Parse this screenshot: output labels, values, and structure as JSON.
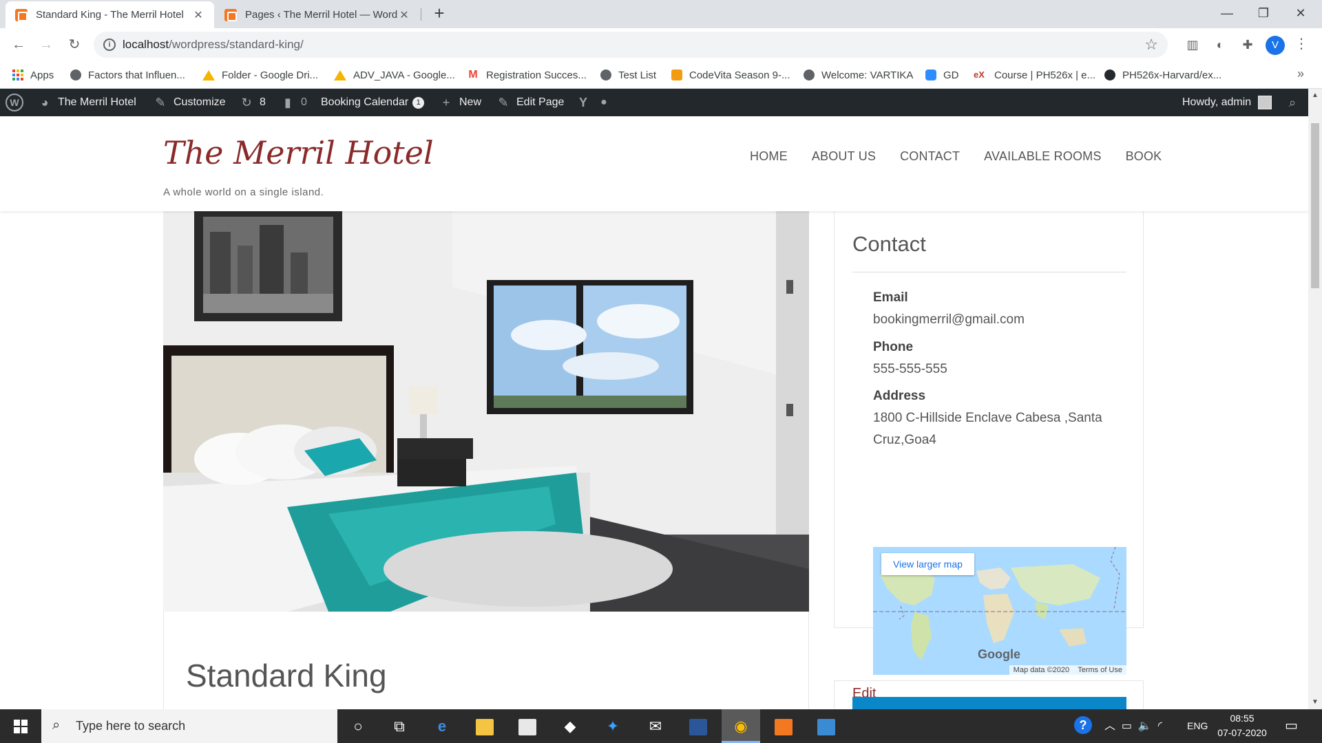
{
  "browser": {
    "tabs": [
      {
        "title": "Standard King - The Merril Hotel",
        "active": true
      },
      {
        "title": "Pages ‹ The Merril Hotel — Word",
        "active": false
      }
    ],
    "url_host": "localhost",
    "url_path": "/wordpress/standard-king/",
    "profile_initial": "V",
    "bookmarks": [
      {
        "label": "Apps",
        "icon": "apps-grid-icon"
      },
      {
        "label": "Factors that Influen...",
        "icon": "globe-icon"
      },
      {
        "label": "Folder - Google Dri...",
        "icon": "google-drive-icon"
      },
      {
        "label": "ADV_JAVA - Google...",
        "icon": "google-drive-icon"
      },
      {
        "label": "Registration Succes...",
        "icon": "gmail-icon"
      },
      {
        "label": "Test List",
        "icon": "globe-icon"
      },
      {
        "label": "CodeVita Season 9-...",
        "icon": "codevita-icon"
      },
      {
        "label": "Welcome: VARTIKA",
        "icon": "globe-icon"
      },
      {
        "label": "GD",
        "icon": "zoom-icon"
      },
      {
        "label": "Course | PH526x | e...",
        "icon": "edx-icon"
      },
      {
        "label": "PH526x-Harvard/ex...",
        "icon": "github-icon"
      }
    ]
  },
  "wp_admin_bar": {
    "site_name": "The Merril Hotel",
    "customize": "Customize",
    "updates": "8",
    "comments": "0",
    "booking_calendar": "Booking Calendar",
    "booking_badge": "1",
    "new": "New",
    "edit_page": "Edit Page",
    "howdy": "Howdy, admin"
  },
  "site": {
    "title": "The Merril Hotel",
    "tagline": "A whole world on a single island.",
    "menu": [
      "HOME",
      "ABOUT US",
      "CONTACT",
      "AVAILABLE ROOMS",
      "BOOK"
    ]
  },
  "post": {
    "title": "Standard King"
  },
  "contact_widget": {
    "title": "Contact",
    "email_label": "Email",
    "email": "bookingmerril@gmail.com",
    "phone_label": "Phone",
    "phone": "555-555-555",
    "address_label": "Address",
    "address": "1800 C-Hillside Enclave Cabesa ,Santa Cruz,Goa4",
    "map_button": "View larger map",
    "map_logo": "Google",
    "map_data": "Map data ©2020",
    "map_terms": "Terms of Use",
    "edit": "Edit"
  },
  "taskbar": {
    "search_placeholder": "Type here to search",
    "language": "ENG",
    "time": "08:55",
    "date": "07-07-2020"
  },
  "colors": {
    "site_title": "#8a2a2a",
    "wp_bar": "#23282d",
    "accent_blue": "#0a87c8"
  }
}
